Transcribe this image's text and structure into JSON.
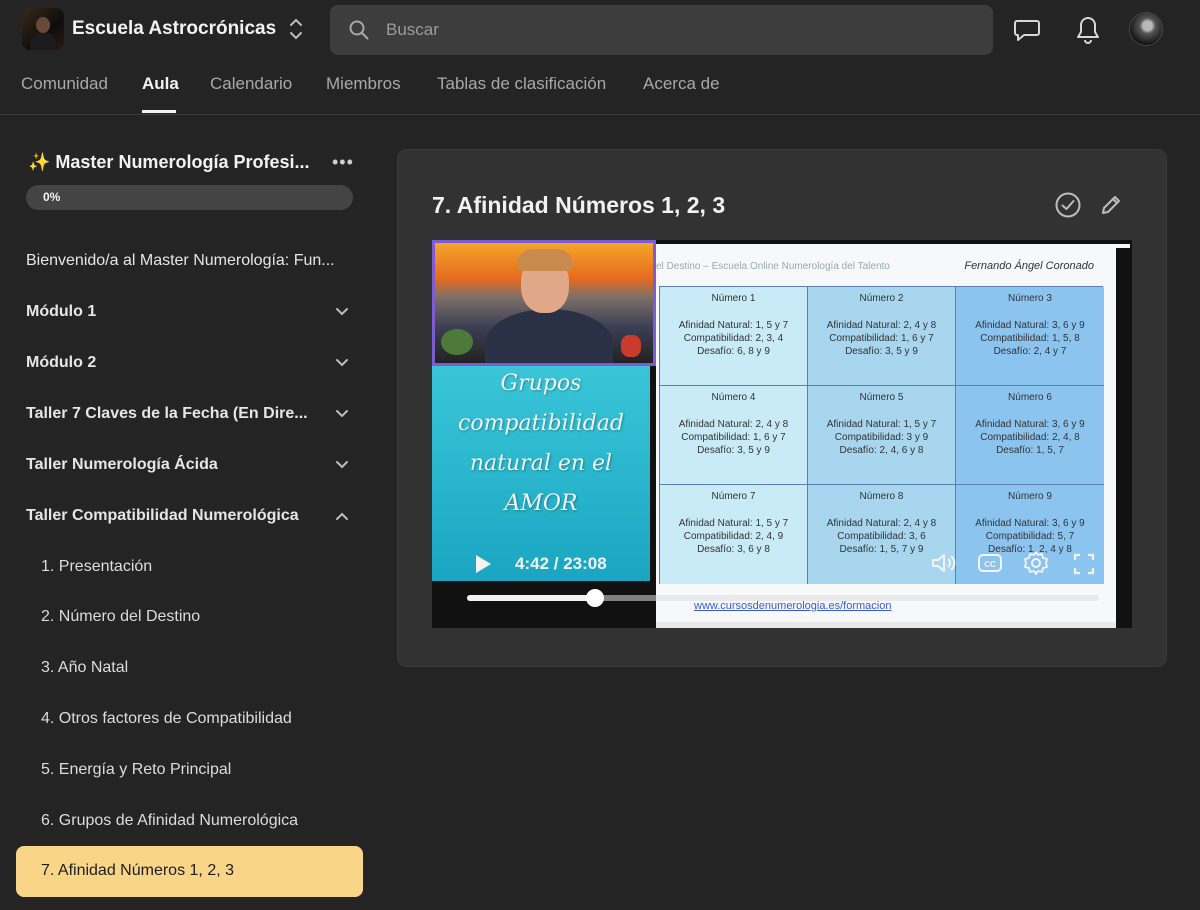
{
  "header": {
    "school_name": "Escuela Astrocrónicas",
    "search_placeholder": "Buscar"
  },
  "nav": {
    "tabs": [
      {
        "label": "Comunidad"
      },
      {
        "label": "Aula"
      },
      {
        "label": "Calendario"
      },
      {
        "label": "Miembros"
      },
      {
        "label": "Tablas de clasificación"
      },
      {
        "label": "Acerca de"
      }
    ],
    "active_index": 1
  },
  "sidebar": {
    "course_title": "✨ Master Numerología Profesi...",
    "more_label": "•••",
    "progress_label": "0%",
    "progress_value": 0,
    "items": [
      {
        "label": "Bienvenido/a al Master Numerología: Fun..."
      },
      {
        "label": "Módulo 1"
      },
      {
        "label": "Módulo 2"
      },
      {
        "label": "Taller 7 Claves de la Fecha (En Dire..."
      },
      {
        "label": "Taller Numerología Ácida"
      },
      {
        "label": "Taller Compatibilidad Numerológica"
      }
    ],
    "lessons": [
      {
        "label": "1. Presentación"
      },
      {
        "label": "2. Número del Destino"
      },
      {
        "label": "3. Año Natal"
      },
      {
        "label": "4. Otros factores de Compatibilidad"
      },
      {
        "label": "5. Energía y Reto Principal"
      },
      {
        "label": "6. Grupos de Afinidad Numerológica"
      },
      {
        "label": "7. Afinidad Números 1, 2, 3"
      }
    ],
    "active_lesson": "7. Afinidad Números 1, 2, 3"
  },
  "content": {
    "title": "7. Afinidad Números 1, 2, 3"
  },
  "video": {
    "time": "4:42 / 23:08",
    "progress_fraction": 0.203,
    "slide": {
      "header": "el Destino – Escuela Online Numerología del Talento",
      "signature": "Fernando Ángel Coronado",
      "url": "www.cursosdenumerologia.es/formacion",
      "cells": [
        {
          "title": "Número 1",
          "l1": "Afinidad Natural: 1, 5 y 7",
          "l2": "Compatibilidad: 2, 3, 4",
          "l3": "Desafío: 6, 8 y 9"
        },
        {
          "title": "Número 2",
          "l1": "Afinidad Natural: 2, 4 y 8",
          "l2": "Compatibilidad: 1, 6 y 7",
          "l3": "Desafío: 3, 5 y 9"
        },
        {
          "title": "Número 3",
          "l1": "Afinidad Natural: 3, 6 y 9",
          "l2": "Compatibilidad: 1, 5, 8",
          "l3": "Desafío: 2, 4 y 7"
        },
        {
          "title": "Número 4",
          "l1": "Afinidad Natural: 2, 4 y 8",
          "l2": "Compatibilidad: 1, 6 y 7",
          "l3": "Desafío: 3, 5 y 9"
        },
        {
          "title": "Número 5",
          "l1": "Afinidad Natural: 1, 5 y 7",
          "l2": "Compatibilidad: 3 y 9",
          "l3": "Desafío: 2, 4, 6 y 8"
        },
        {
          "title": "Número 6",
          "l1": "Afinidad Natural: 3, 6 y 9",
          "l2": "Compatibilidad: 2, 4, 8",
          "l3": "Desafío: 1, 5, 7"
        },
        {
          "title": "Número 7",
          "l1": "Afinidad Natural: 1, 5 y 7",
          "l2": "Compatibilidad: 2, 4, 9",
          "l3": "Desafío: 3, 6 y 8"
        },
        {
          "title": "Número 8",
          "l1": "Afinidad Natural: 2, 4 y 8",
          "l2": "Compatibilidad: 3, 6",
          "l3": "Desafío: 1, 5, 7 y 9"
        },
        {
          "title": "Número 9",
          "l1": "Afinidad Natural: 3, 6 y 9",
          "l2": "Compatibilidad: 5, 7",
          "l3": "Desafío: 1, 2, 4 y 8"
        }
      ]
    },
    "overlay_text": [
      "Grupos",
      "compatibilidad",
      "natural en el",
      "AMOR"
    ]
  },
  "icons": {
    "switch": "chevron-up-down-icon",
    "search": "search-icon",
    "chat": "chat-icon",
    "bell": "bell-icon",
    "check": "check-circle-icon",
    "edit": "pencil-icon",
    "play": "play-icon",
    "volume": "volume-icon",
    "cc": "closed-captions-icon",
    "settings": "gear-icon",
    "fullscreen": "fullscreen-icon"
  },
  "colors": {
    "active_lesson_bg": "#f9d587",
    "webcam_border": "#7c5cd0"
  }
}
